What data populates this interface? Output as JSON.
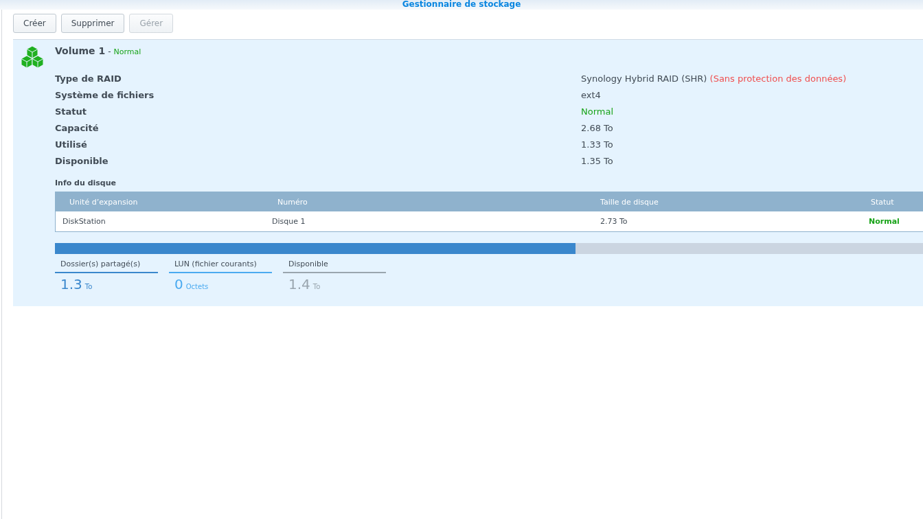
{
  "window": {
    "title": "Gestionnaire de stockage"
  },
  "toolbar": [
    {
      "label": "Créer",
      "disabled": false
    },
    {
      "label": "Supprimer",
      "disabled": false
    },
    {
      "label": "Gérer",
      "disabled": true
    }
  ],
  "volume": {
    "name": "Volume 1",
    "separator": "-",
    "status": "Normal",
    "properties": [
      {
        "label": "Type de RAID",
        "value": "Synology Hybrid RAID (SHR)",
        "note": "(Sans protection des données)",
        "kind": "text"
      },
      {
        "label": "Système de fichiers",
        "value": "ext4",
        "kind": "text"
      },
      {
        "label": "Statut",
        "value": "Normal",
        "kind": "status"
      },
      {
        "label": "Capacité",
        "value": "2.68 To",
        "kind": "text"
      },
      {
        "label": "Utilisé",
        "value": "1.33 To",
        "kind": "text"
      },
      {
        "label": "Disponible",
        "value": "1.35 To",
        "kind": "text"
      }
    ],
    "disk_info": {
      "title": "Info du disque",
      "columns": [
        "Unité d’expansion",
        "Numéro",
        "Taille de disque",
        "Statut"
      ],
      "rows": [
        {
          "cells": [
            "DiskStation",
            "Disque 1",
            "2.73 To",
            "Normal"
          ]
        }
      ]
    },
    "usage": {
      "level": 0.6
    },
    "legend": [
      {
        "label": "Dossier(s) partagé(s)",
        "value": "1.3",
        "unit": "To",
        "color": "#3a87cc"
      },
      {
        "label": "LUN (fichier courants)",
        "value": "0",
        "unit": "Octets",
        "color": "#4aaaf0"
      },
      {
        "label": "Disponible",
        "value": "1.4",
        "unit": "To",
        "color": "#99a5ae"
      }
    ]
  }
}
